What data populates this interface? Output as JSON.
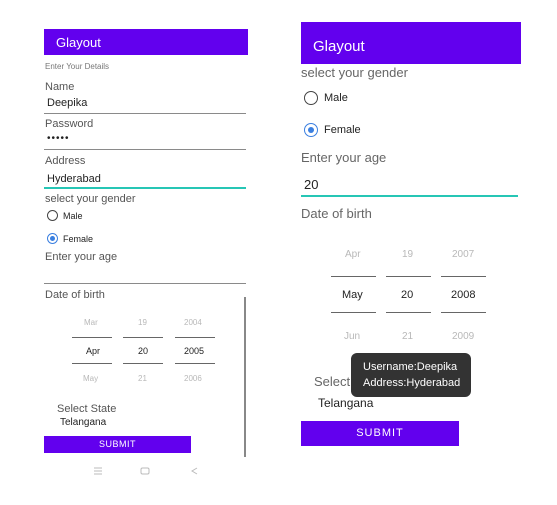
{
  "left": {
    "app_title": "Glayout",
    "subtitle": "Enter Your Details",
    "name_label": "Name",
    "name_value": "Deepika",
    "password_label": "Password",
    "password_value": "•••••",
    "address_label": "Address",
    "address_value": "Hyderabad",
    "gender_label": "select your gender",
    "gender_options": [
      "Male",
      "Female"
    ],
    "gender_selected": "Female",
    "age_label": "Enter your age",
    "age_value": "",
    "dob_label": "Date of birth",
    "date_picker": {
      "prev": [
        "Mar",
        "19",
        "2004"
      ],
      "current": [
        "Apr",
        "20",
        "2005"
      ],
      "next": [
        "May",
        "21",
        "2006"
      ]
    },
    "state_label": "Select State",
    "state_value": "Telangana",
    "submit_label": "SUBMIT",
    "nav_icons": [
      "menu-icon",
      "home-icon",
      "back-icon"
    ]
  },
  "right": {
    "app_title": "Glayout",
    "gender_label": "select your gender",
    "gender_options": [
      "Male",
      "Female"
    ],
    "gender_selected": "Female",
    "age_label": "Enter your age",
    "age_value": "20",
    "dob_label": "Date of birth",
    "date_picker": {
      "prev": [
        "Apr",
        "19",
        "2007"
      ],
      "current": [
        "May",
        "20",
        "2008"
      ],
      "next": [
        "Jun",
        "21",
        "2009"
      ]
    },
    "state_label_partial": "Select",
    "state_value": "Telangana",
    "toast_line1": "Username:Deepika",
    "toast_line2": "Address:Hyderabad",
    "submit_label": "SUBMIT"
  },
  "colors": {
    "primary": "#6200ee",
    "accent": "#26c6b5",
    "radio_checked": "#3a7fe0"
  }
}
